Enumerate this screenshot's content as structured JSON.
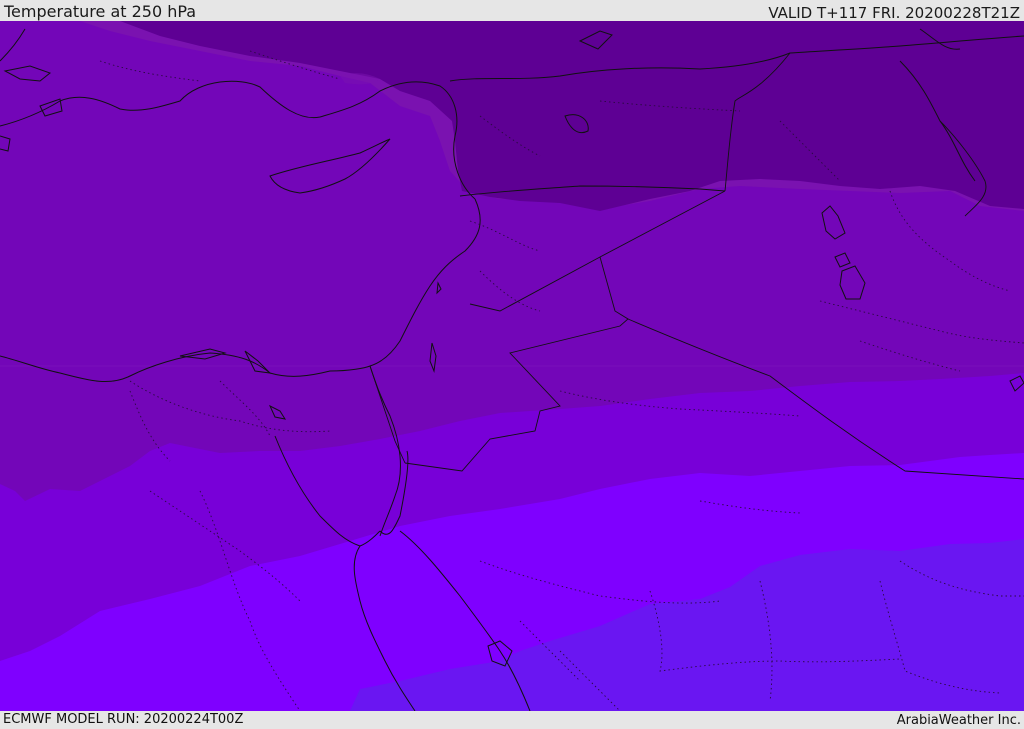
{
  "header": {
    "title": "Temperature at 250 hPa",
    "valid": "VALID T+117 FRI. 20200228T21Z"
  },
  "footer": {
    "model_run": "ECMWF MODEL RUN: 20200224T00Z",
    "credit": "ArabiaWeather Inc."
  },
  "map": {
    "variable": "temperature",
    "level": "250 hPa",
    "palette": [
      "#5e0094",
      "#7a12b0",
      "#7306b8",
      "#7800d8",
      "#7f00ff",
      "#6a16f2"
    ],
    "region_label": "Eastern Mediterranean / Middle East"
  }
}
